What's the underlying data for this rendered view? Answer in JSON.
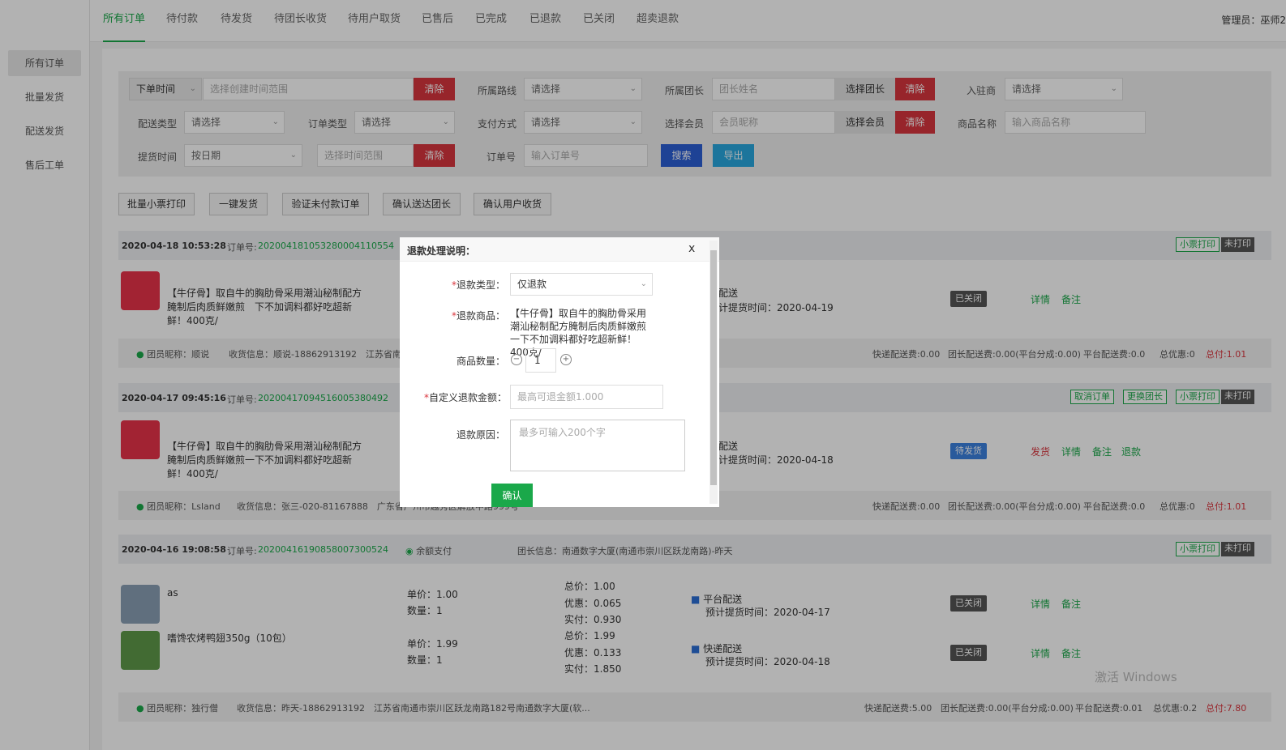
{
  "sidebar": {
    "items": [
      {
        "label": "所有订单"
      },
      {
        "label": "批量发货"
      },
      {
        "label": "配送发货"
      },
      {
        "label": "售后工单"
      }
    ]
  },
  "tabs": [
    {
      "label": "所有订单"
    },
    {
      "label": "待付款"
    },
    {
      "label": "待发货"
    },
    {
      "label": "待团长收货"
    },
    {
      "label": "待用户取货"
    },
    {
      "label": "已售后"
    },
    {
      "label": "已完成"
    },
    {
      "label": "已退款"
    },
    {
      "label": "已关闭"
    },
    {
      "label": "超卖退款"
    }
  ],
  "admin": "管理员：巫师2",
  "filters": {
    "order_time": "下单时间",
    "time_placeholder": "选择创建时间范围",
    "clear": "清除",
    "route_label": "所属路线",
    "route_value": "请选择",
    "leader_label": "所属团长",
    "leader_placeholder": "团长姓名",
    "choose_leader": "选择团长",
    "stationed_label": "入驻商",
    "stationed_value": "请选择",
    "delivery_label": "配送类型",
    "delivery_value": "请选择",
    "order_type_label": "订单类型",
    "order_type_value": "请选择",
    "pay_label": "支付方式",
    "pay_value": "请选择",
    "member_label": "选择会员",
    "member_placeholder": "会员昵称",
    "choose_member": "选择会员",
    "product_label": "商品名称",
    "product_placeholder": "输入商品名称",
    "pickup_label": "提货时间",
    "pickup_value": "按日期",
    "pickup_placeholder": "选择时间范围",
    "order_no_label": "订单号",
    "order_no_placeholder": "输入订单号",
    "search": "搜索",
    "export": "导出"
  },
  "actions": [
    "批量小票打印",
    "一键发货",
    "验证未付款订单",
    "确认送达团长",
    "确认用户收货"
  ],
  "orders": [
    {
      "time": "2020-04-18 10:53:28",
      "no_label": "订单号:",
      "no": "20200418105328000411055​4",
      "tags": [
        "小票打印",
        "未打印"
      ],
      "product": "【牛仔骨】取自牛的胸肋骨采用潮汕秘制配方腌制后肉质鲜嫩煎　下不加调料都好吃超新鲜！400克/",
      "delivery": "配送",
      "pickup": "计提货时间：2020-04-19",
      "status": "已关闭",
      "links": [
        "详情",
        "备注"
      ],
      "foot_member": "团员昵称：顺说",
      "foot_info": "收货信息：顺说-18862913192　江苏省南通",
      "foot_fees": [
        "快递配送费:0.00",
        "团长配送费:0.00(平台分成:0.00)",
        "平台配送费:0.0",
        "总优惠:0"
      ],
      "foot_total": "总付:1.01"
    },
    {
      "time": "2020-04-17 09:45:16",
      "no_label": "订单号:",
      "no": "20200417094516005380492",
      "tags": [
        "取消订单",
        "更换团长",
        "小票打印",
        "未打印"
      ],
      "product": "【牛仔骨】取自牛的胸肋骨采用潮汕秘制配方腌制后肉质鲜嫩煎一下不加调料都好吃超新鲜！400克/",
      "delivery": "配送",
      "pickup": "计提货时间：2020-04-18",
      "status": "待发货",
      "links": [
        "发货",
        "详情",
        "备注",
        "退款"
      ],
      "foot_member": "团员昵称：Lsland",
      "foot_info": "收货信息：张三-020-81167888　广东省广州市越秀区解放中路999号",
      "foot_fees": [
        "快递配送费:0.00",
        "团长配送费:0.00(平台分成:0.00)",
        "平台配送费:0.0",
        "总优惠:0"
      ],
      "foot_total": "总付:1.01"
    },
    {
      "time": "2020-04-16 19:08:58",
      "no_label": "订单号:",
      "no": "20200416190858007300524",
      "pay": "余额支付",
      "leader_info": "团长信息：南通数字大厦(南通市崇川区跃龙南路)-昨天",
      "tags": [
        "小票打印",
        "未打印"
      ],
      "items": [
        {
          "name": "as",
          "price": "单价：1.00",
          "qty": "数量：1",
          "total": "总价：1.00",
          "discount": "优惠：0.065",
          "paid": "实付：0.930",
          "delivery": "平台配送",
          "pickup": "预计提货时间：2020-04-17",
          "status": "已关闭",
          "links": [
            "详情",
            "备注"
          ]
        },
        {
          "name": "嗜馋农烤鸭翅350g（10包）",
          "price": "单价：1.99",
          "qty": "数量：1",
          "total": "总价：1.99",
          "discount": "优惠：0.133",
          "paid": "实付：1.850",
          "delivery": "快递配送",
          "pickup": "预计提货时间：2020-04-18",
          "status": "已关闭",
          "links": [
            "详情",
            "备注"
          ]
        }
      ],
      "foot_member": "团员昵称：独行僧",
      "foot_info": "收货信息：昨天-18862913192　江苏省南通市崇川区跃龙南路182号南通数字大厦(软...",
      "foot_fees": [
        "快递配送费:5.00",
        "团长配送费:0.00(平台分成:0.00)",
        "平台配送费:0.01",
        "总优惠:0.2"
      ],
      "foot_total": "总付:7.80"
    }
  ],
  "modal": {
    "title": "退款处理说明：",
    "close": "x",
    "type_label": "退款类型：",
    "type_value": "仅退款",
    "product_label": "退款商品：",
    "product_value": "【牛仔骨】取自牛的胸肋骨采用潮汕秘制配方腌制后肉质鲜嫩煎一下不加调料都好吃超新鲜！400克/",
    "qty_label": "商品数量：",
    "qty_value": "1",
    "amount_label": "自定义退款金额：",
    "amount_placeholder": "最高可退金额1.000",
    "reason_label": "退款原因：",
    "reason_placeholder": "最多可输入200个字",
    "confirm": "确认"
  },
  "watermark": "激活 Windows"
}
